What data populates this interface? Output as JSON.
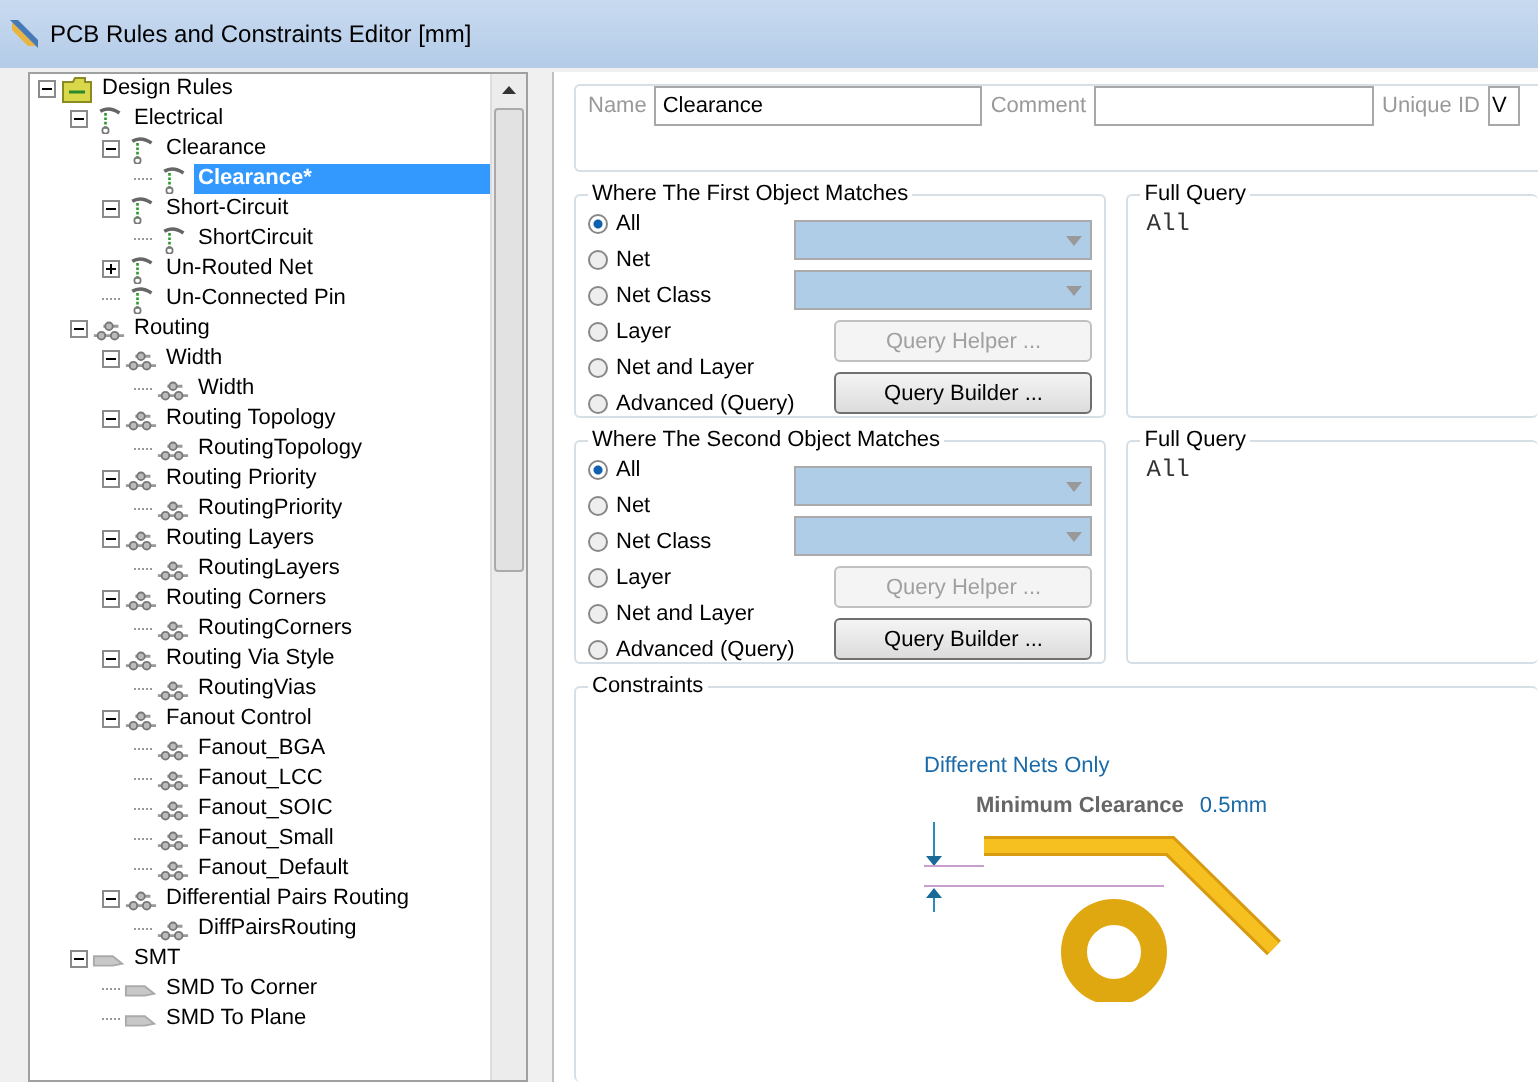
{
  "window": {
    "title": "PCB Rules and Constraints Editor [mm]"
  },
  "tree": [
    {
      "label": "Design Rules",
      "kind": "folder",
      "expanded": true,
      "selected": false,
      "children": [
        {
          "label": "Electrical",
          "kind": "electrical",
          "expanded": true,
          "selected": false,
          "children": [
            {
              "label": "Clearance",
              "kind": "electrical",
              "expanded": true,
              "selected": false,
              "children": [
                {
                  "label": "Clearance*",
                  "kind": "electrical",
                  "selected": true
                }
              ]
            },
            {
              "label": "Short-Circuit",
              "kind": "electrical",
              "expanded": true,
              "selected": false,
              "children": [
                {
                  "label": "ShortCircuit",
                  "kind": "electrical",
                  "selected": false
                }
              ]
            },
            {
              "label": "Un-Routed Net",
              "kind": "electrical",
              "expanded": false,
              "selected": false
            },
            {
              "label": "Un-Connected Pin",
              "kind": "electrical",
              "selected": false
            }
          ]
        },
        {
          "label": "Routing",
          "kind": "routing",
          "expanded": true,
          "selected": false,
          "children": [
            {
              "label": "Width",
              "kind": "routing",
              "expanded": true,
              "selected": false,
              "children": [
                {
                  "label": "Width",
                  "kind": "routing",
                  "selected": false
                }
              ]
            },
            {
              "label": "Routing Topology",
              "kind": "routing",
              "expanded": true,
              "selected": false,
              "children": [
                {
                  "label": "RoutingTopology",
                  "kind": "routing",
                  "selected": false
                }
              ]
            },
            {
              "label": "Routing Priority",
              "kind": "routing",
              "expanded": true,
              "selected": false,
              "children": [
                {
                  "label": "RoutingPriority",
                  "kind": "routing",
                  "selected": false
                }
              ]
            },
            {
              "label": "Routing Layers",
              "kind": "routing",
              "expanded": true,
              "selected": false,
              "children": [
                {
                  "label": "RoutingLayers",
                  "kind": "routing",
                  "selected": false
                }
              ]
            },
            {
              "label": "Routing Corners",
              "kind": "routing",
              "expanded": true,
              "selected": false,
              "children": [
                {
                  "label": "RoutingCorners",
                  "kind": "routing",
                  "selected": false
                }
              ]
            },
            {
              "label": "Routing Via Style",
              "kind": "routing",
              "expanded": true,
              "selected": false,
              "children": [
                {
                  "label": "RoutingVias",
                  "kind": "routing",
                  "selected": false
                }
              ]
            },
            {
              "label": "Fanout Control",
              "kind": "routing",
              "expanded": true,
              "selected": false,
              "children": [
                {
                  "label": "Fanout_BGA",
                  "kind": "routing",
                  "selected": false
                },
                {
                  "label": "Fanout_LCC",
                  "kind": "routing",
                  "selected": false
                },
                {
                  "label": "Fanout_SOIC",
                  "kind": "routing",
                  "selected": false
                },
                {
                  "label": "Fanout_Small",
                  "kind": "routing",
                  "selected": false
                },
                {
                  "label": "Fanout_Default",
                  "kind": "routing",
                  "selected": false
                }
              ]
            },
            {
              "label": "Differential Pairs Routing",
              "kind": "routing",
              "expanded": true,
              "selected": false,
              "children": [
                {
                  "label": "DiffPairsRouting",
                  "kind": "routing",
                  "selected": false
                }
              ]
            }
          ]
        },
        {
          "label": "SMT",
          "kind": "smt",
          "expanded": true,
          "selected": false,
          "children": [
            {
              "label": "SMD To Corner",
              "kind": "smt",
              "selected": false
            },
            {
              "label": "SMD To Plane",
              "kind": "smt",
              "selected": false
            }
          ]
        }
      ]
    }
  ],
  "rule": {
    "name_label": "Name",
    "name_value": "Clearance",
    "comment_label": "Comment",
    "unique_id_label": "Unique ID",
    "unique_id_value": "V"
  },
  "matches": [
    {
      "title": "Where The First Object Matches",
      "options": [
        {
          "label": "All",
          "selected": true
        },
        {
          "label": "Net",
          "selected": false
        },
        {
          "label": "Net Class",
          "selected": false
        },
        {
          "label": "Layer",
          "selected": false
        },
        {
          "label": "Net and Layer",
          "selected": false
        },
        {
          "label": "Advanced (Query)",
          "selected": false
        }
      ],
      "controls": [
        {
          "kind": "dropdown"
        },
        {
          "kind": "dropdown"
        },
        {
          "kind": "button",
          "label": "Query Helper ...",
          "disabled": true
        },
        {
          "kind": "button",
          "label": "Query Builder ...",
          "disabled": false
        }
      ],
      "query_title": "Full Query",
      "query": "All"
    },
    {
      "title": "Where The Second Object Matches",
      "options": [
        {
          "label": "All",
          "selected": true
        },
        {
          "label": "Net",
          "selected": false
        },
        {
          "label": "Net Class",
          "selected": false
        },
        {
          "label": "Layer",
          "selected": false
        },
        {
          "label": "Net and Layer",
          "selected": false
        },
        {
          "label": "Advanced (Query)",
          "selected": false
        }
      ],
      "controls": [
        {
          "kind": "dropdown"
        },
        {
          "kind": "dropdown"
        },
        {
          "kind": "button",
          "label": "Query Helper ...",
          "disabled": true
        },
        {
          "kind": "button",
          "label": "Query Builder ...",
          "disabled": false
        }
      ],
      "query_title": "Full Query",
      "query": "All"
    }
  ],
  "constraints": {
    "title": "Constraints",
    "scope": "Different Nets Only",
    "label": "Minimum Clearance",
    "value": "0.5mm"
  }
}
